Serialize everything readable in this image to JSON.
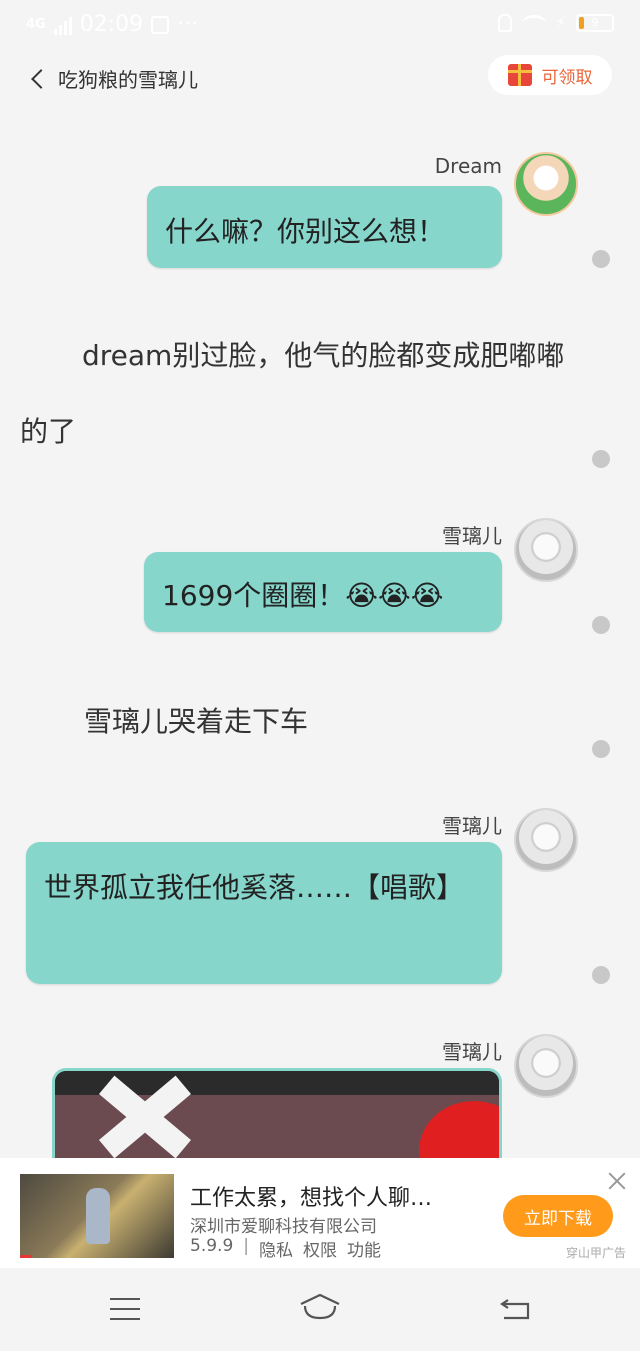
{
  "status_bar": {
    "network": "4G",
    "time": "02:09",
    "battery": "9"
  },
  "nav": {
    "title": "吃狗粮的雪璃儿",
    "claim_label": "可领取"
  },
  "chat": {
    "messages": [
      {
        "sender": "Dream",
        "text": "什么嘛？你别这么想！"
      },
      {
        "narration": "dream别过脸，他气的脸都变成肥嘟嘟的了"
      },
      {
        "sender": "雪璃儿",
        "text": "1699个圈圈！😭😭😭"
      },
      {
        "narration": "雪璃儿哭着走下车"
      },
      {
        "sender": "雪璃儿",
        "text": "世界孤立我任他奚落……【唱歌】"
      },
      {
        "sender": "雪璃儿"
      }
    ]
  },
  "ad": {
    "title": "工作太累，想找个人聊…",
    "company": "深圳市爱聊科技有限公司",
    "version": "5.9.9",
    "privacy": "隐私",
    "permissions": "权限",
    "features": "功能",
    "download_label": "立即下载",
    "source": "穿山甲广告"
  },
  "colors": {
    "bubble": "#87d6cc",
    "accent": "#ff9a1a",
    "background": "#f4f4f4"
  }
}
